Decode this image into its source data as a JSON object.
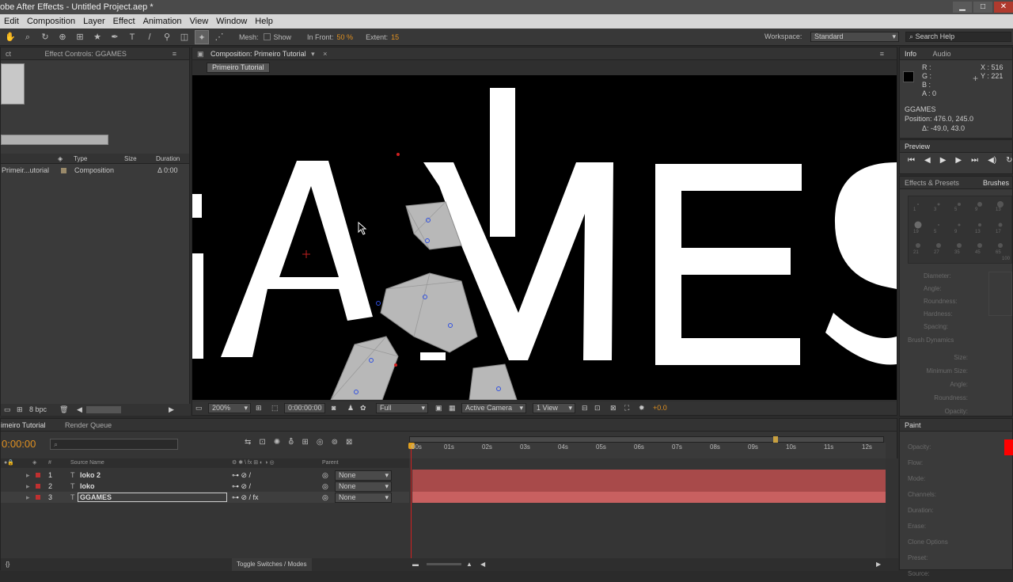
{
  "app": {
    "title": "obe After Effects - Untitled Project.aep *",
    "win_buttons": [
      "▁",
      "□",
      "✕"
    ]
  },
  "menu": [
    "Edit",
    "Composition",
    "Layer",
    "Effect",
    "Animation",
    "View",
    "Window",
    "Help"
  ],
  "toolbar": {
    "mesh_label": "Mesh:",
    "show_label": "Show",
    "infront_label": "In Front:",
    "infront_value": "50 %",
    "extent_label": "Extent:",
    "extent_value": "15",
    "workspace_label": "Workspace:",
    "workspace_value": "Standard",
    "search_placeholder": "Search Help"
  },
  "project_panel": {
    "tab_left": "ct",
    "tab_effect": "Effect Controls: GGAMES",
    "col_type": "Type",
    "col_size": "Size",
    "col_duration": "Duration",
    "item_name": "Primeir...utorial",
    "item_type": "Composition",
    "item_duration": "Δ 0:00",
    "bpc": "8 bpc"
  },
  "comp_panel": {
    "tab": "Composition: Primeiro Tutorial",
    "breadcrumb": "Primeiro Tutorial",
    "zoom": "200%",
    "timecode": "0:00:00:00",
    "resolution": "Full",
    "camera": "Active Camera",
    "views": "1 View",
    "exposure": "+0.0",
    "canvas_text": "GAMES"
  },
  "info_panel": {
    "tab_info": "Info",
    "tab_audio": "Audio",
    "r": "R :",
    "g": "G :",
    "b": "B :",
    "a": "A : 0",
    "x": "X : 516",
    "y": "Y : 221",
    "layer": "GGAMES",
    "position": "Position: 476.0, 245.0",
    "delta": "Δ: -49.0, 43.0"
  },
  "preview_panel": {
    "tab": "Preview"
  },
  "brushes_panel": {
    "tab_effects": "Effects & Presets",
    "tab_brushes": "Brushes",
    "diameter": "Diameter:",
    "angle": "Angle:",
    "roundness": "Roundness:",
    "hardness": "Hardness:",
    "spacing": "Spacing:",
    "dynamics": "Brush Dynamics",
    "size": "Size:",
    "min_size": "Minimum Size:",
    "angle2": "Angle:",
    "roundness2": "Roundness:",
    "opacity": "Opacity:",
    "brush_sizes": [
      "1",
      "3",
      "5",
      "9",
      "13",
      "19",
      "5",
      "9",
      "13",
      "17",
      "21",
      "27",
      "35",
      "45",
      "65",
      "100"
    ]
  },
  "paint_panel": {
    "tab": "Paint",
    "opacity": "Opacity:",
    "flow": "Flow:",
    "mode": "Mode:",
    "channels": "Channels:",
    "duration": "Duration:",
    "erase": "Erase:",
    "clone_options": "Clone Options",
    "preset": "Preset:",
    "source": "Source:"
  },
  "timeline": {
    "tab": "imeiro Tutorial",
    "tab_render": "Render Queue",
    "timecode": "0:00:00",
    "col_source": "Source Name",
    "col_parent": "Parent",
    "ticks": [
      "00s",
      "01s",
      "02s",
      "03s",
      "04s",
      "05s",
      "06s",
      "07s",
      "08s",
      "09s",
      "10s",
      "11s",
      "12s"
    ],
    "layers": [
      {
        "num": "1",
        "name": "loko 2",
        "parent": "None"
      },
      {
        "num": "2",
        "name": "loko",
        "parent": "None"
      },
      {
        "num": "3",
        "name": "GGAMES",
        "parent": "None"
      }
    ],
    "toggle": "Toggle Switches / Modes"
  }
}
